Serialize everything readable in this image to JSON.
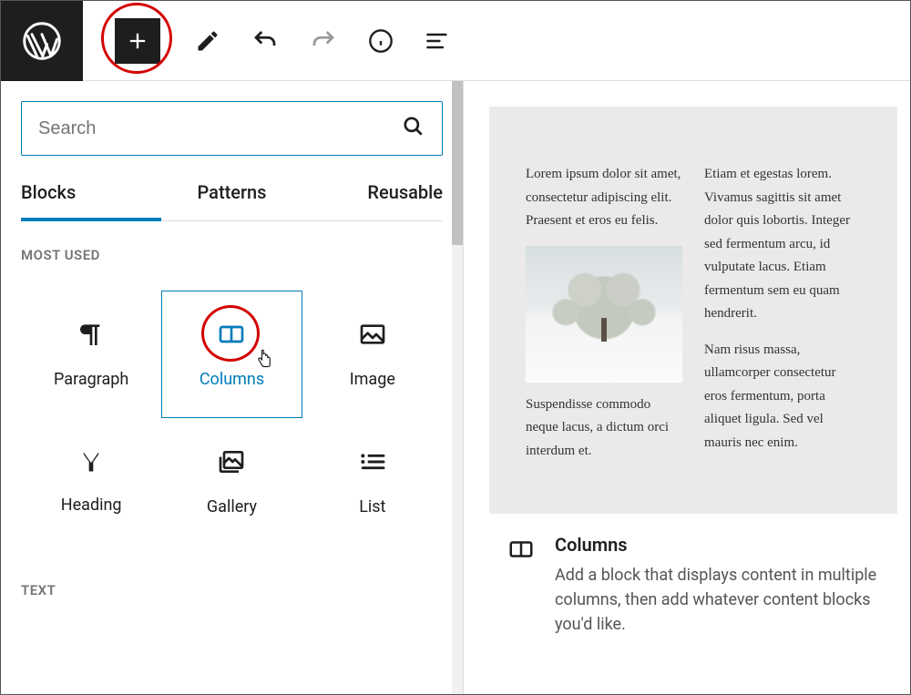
{
  "toolbar": {
    "add_label": "+"
  },
  "inserter": {
    "search_placeholder": "Search",
    "tabs": [
      "Blocks",
      "Patterns",
      "Reusable"
    ],
    "section_most_used": "MOST USED",
    "section_text": "TEXT",
    "blocks": [
      {
        "label": "Paragraph"
      },
      {
        "label": "Columns"
      },
      {
        "label": "Image"
      },
      {
        "label": "Heading"
      },
      {
        "label": "Gallery"
      },
      {
        "label": "List"
      }
    ]
  },
  "preview": {
    "col1": {
      "p1": "Lorem ipsum dolor sit amet, consectetur adipiscing elit. Praesent et eros eu felis.",
      "p2": "Suspendisse commodo neque lacus, a dictum orci interdum et."
    },
    "col2": {
      "p1": "Etiam et egestas lorem. Vivamus sagittis sit amet dolor quis lobortis. Integer sed fermentum arcu, id vulputate lacus. Etiam fermentum sem eu quam hendrerit.",
      "p2": "Nam risus massa, ullamcorper consectetur eros fermentum, porta aliquet ligula. Sed vel mauris nec enim."
    }
  },
  "info": {
    "title": "Columns",
    "desc": "Add a block that displays content in multiple columns, then add whatever content blocks you'd like."
  }
}
